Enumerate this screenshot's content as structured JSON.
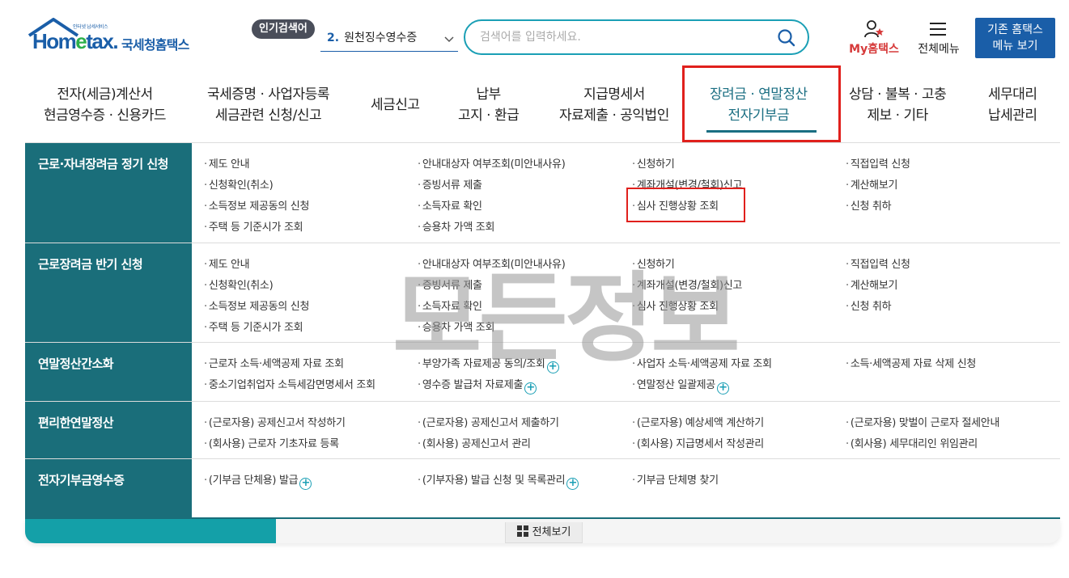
{
  "header": {
    "logo_tagline": "인터넷 납세서비스",
    "logo_brand_part1": "Hom",
    "logo_brand_e": "e",
    "logo_brand_part2": "tax.",
    "logo_korean": "국세청홈택스",
    "popular_label": "인기검색어",
    "popular_rank": "2.",
    "popular_term": "원천징수영수증",
    "search_placeholder": "검색어를 입력하세요.",
    "my_hometax": "My홈택스",
    "all_menu": "전체메뉴",
    "old_home_line1": "기존 홈택스",
    "old_home_line2": "메뉴 보기"
  },
  "nav": {
    "items": [
      {
        "line1": "전자(세금)계산서",
        "line2": "현금영수증 · 신용카드"
      },
      {
        "line1": "국세증명 · 사업자등록",
        "line2": "세금관련 신청/신고"
      },
      {
        "line1": "세금신고",
        "line2": ""
      },
      {
        "line1": "납부",
        "line2": "고지 · 환급"
      },
      {
        "line1": "지급명세서",
        "line2": "자료제출 · 공익법인"
      },
      {
        "line1": "장려금 · 연말정산",
        "line2": "전자기부금"
      },
      {
        "line1": "상담 · 불복 · 고충",
        "line2": "제보 · 기타"
      },
      {
        "line1": "세무대리",
        "line2": "납세관리"
      }
    ]
  },
  "sections": [
    {
      "title": "근로·자녀장려금 정기 신청",
      "links": [
        "제도 안내",
        "안내대상자 여부조회(미안내사유)",
        "신청하기",
        "직접입력 신청",
        "신청확인(취소)",
        "증빙서류 제출",
        "계좌개설(변경/철회)신고",
        "계산해보기",
        "소득정보 제공동의 신청",
        "소득자료 확인",
        "심사 진행상황 조회",
        "신청 취하",
        "주택 등 기준시가 조회",
        "승용차 가액 조회"
      ]
    },
    {
      "title": "근로장려금 반기 신청",
      "links": [
        "제도 안내",
        "안내대상자 여부조회(미안내사유)",
        "신청하기",
        "직접입력 신청",
        "신청확인(취소)",
        "증빙서류 제출",
        "계좌개설(변경/철회)신고",
        "계산해보기",
        "소득정보 제공동의 신청",
        "소득자료 확인",
        "심사 진행상황 조회",
        "신청 취하",
        "주택 등 기준시가 조회",
        "승용차 가액 조회"
      ]
    },
    {
      "title": "연말정산간소화",
      "links": [
        "근로자 소득·세액공제 자료 조회",
        "부양가족 자료제공 동의/조회",
        "사업자 소득·세액공제 자료 조회",
        "소득·세액공제 자료 삭제 신청",
        "중소기업취업자 소득세감면명세서 조회",
        "영수증 발급처 자료제출",
        "연말정산 일괄제공"
      ]
    },
    {
      "title": "편리한연말정산",
      "links": [
        "(근로자용) 공제신고서 작성하기",
        "(근로자용) 공제신고서 제출하기",
        "(근로자용) 예상세액 계산하기",
        "(근로자용) 맞벌이 근로자 절세안내",
        "(회사용) 근로자 기초자료 등록",
        "(회사용) 공제신고서 관리",
        "(회사용) 지급명세서 작성관리",
        "(회사용) 세무대리인 위임관리"
      ]
    },
    {
      "title": "전자기부금영수증",
      "links": [
        "(기부금 단체용) 발급",
        "(기부자용) 발급 신청 및 목록관리",
        "기부금 단체명 찾기"
      ]
    }
  ],
  "footer": {
    "view_all": "전체보기"
  },
  "watermark": "모든정보",
  "colors": {
    "brand_blue": "#1a5ea8",
    "teal": "#1a6e7a",
    "highlight_red": "#e0201c",
    "accent_cyan": "#1a9fb5"
  }
}
